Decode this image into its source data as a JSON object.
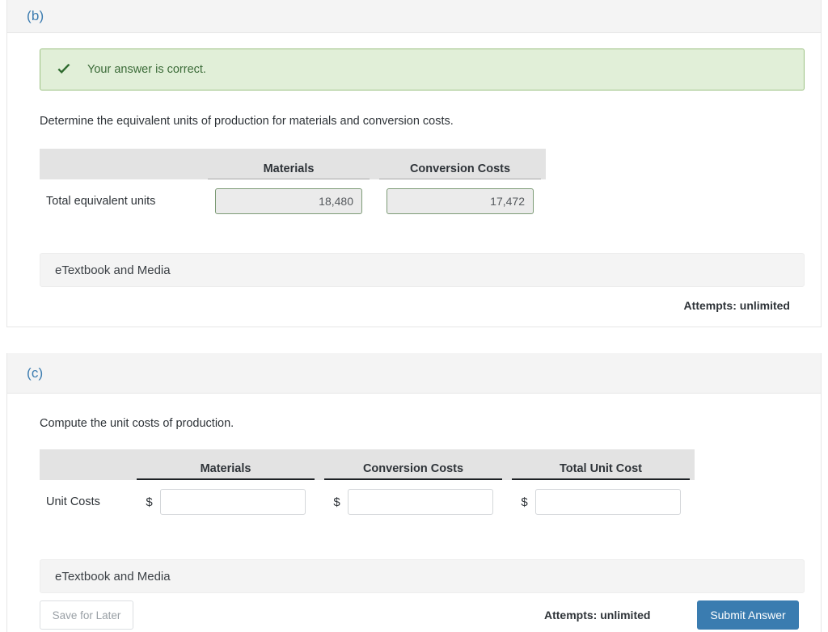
{
  "colors": {
    "part_label": "#3c7cb0",
    "alert_bg": "#e1efd8",
    "alert_border": "#9cc182",
    "alert_text": "#3b6b38",
    "correct_field_border": "#7d9b76",
    "correct_field_bg": "#ebebeb",
    "submit_blue": "#3a7cb0",
    "panel_header_bg": "#f4f4f4",
    "table_header_bg": "#e3e3e3"
  },
  "part_b": {
    "label": "(b)",
    "alert": {
      "icon": "check-icon",
      "message": "Your answer is correct."
    },
    "prompt": "Determine the equivalent units of production for materials and conversion costs.",
    "table": {
      "columns": [
        "",
        "Materials",
        "Conversion Costs"
      ],
      "rows": [
        {
          "label": "Total equivalent units",
          "values": [
            "18,480",
            "17,472"
          ]
        }
      ]
    },
    "etextbook_label": "eTextbook and Media",
    "attempts": "Attempts: unlimited"
  },
  "part_c": {
    "label": "(c)",
    "prompt": "Compute the unit costs of production.",
    "table": {
      "columns": [
        "",
        "Materials",
        "Conversion Costs",
        "Total Unit Cost"
      ],
      "rows": [
        {
          "label": "Unit Costs",
          "currency_symbol": "$",
          "values": [
            "",
            "",
            ""
          ],
          "placeholders": [
            "",
            "",
            ""
          ]
        }
      ]
    },
    "etextbook_label": "eTextbook and Media",
    "attempts": "Attempts: unlimited"
  },
  "footer": {
    "save_label": "Save for Later",
    "submit_label": "Submit Answer"
  }
}
